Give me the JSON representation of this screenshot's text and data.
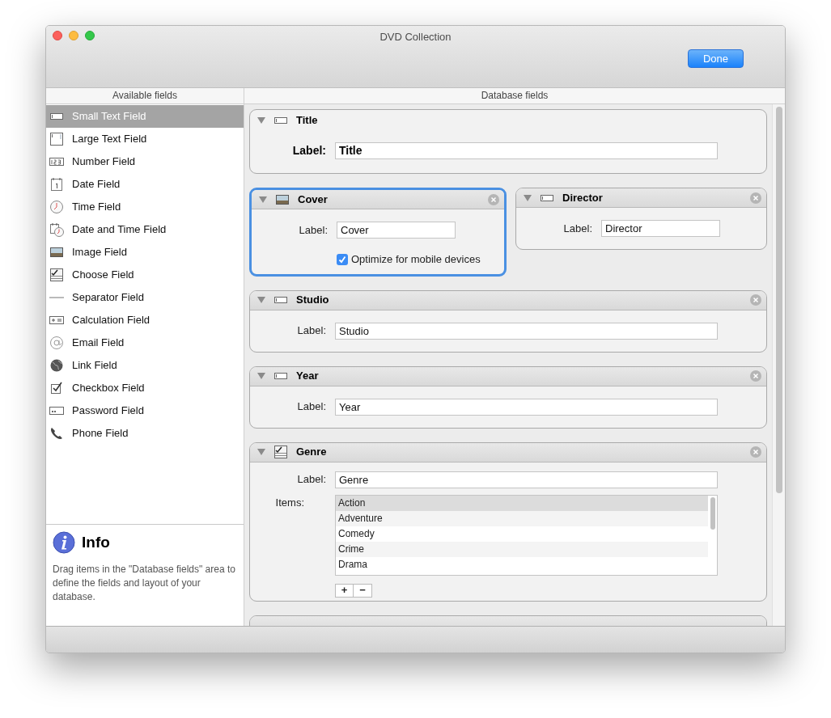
{
  "window": {
    "title": "DVD Collection"
  },
  "toolbar": {
    "done_button": "Done"
  },
  "available_fields": {
    "header": "Available fields",
    "items": [
      {
        "kind": "small_text",
        "label": "Small Text Field",
        "selected": true
      },
      {
        "kind": "large_text",
        "label": "Large Text Field",
        "selected": false
      },
      {
        "kind": "number",
        "label": "Number Field",
        "selected": false
      },
      {
        "kind": "date",
        "label": "Date Field",
        "selected": false
      },
      {
        "kind": "time",
        "label": "Time Field",
        "selected": false
      },
      {
        "kind": "datetime",
        "label": "Date and Time Field",
        "selected": false
      },
      {
        "kind": "image",
        "label": "Image Field",
        "selected": false
      },
      {
        "kind": "choose",
        "label": "Choose Field",
        "selected": false
      },
      {
        "kind": "separator",
        "label": "Separator Field",
        "selected": false
      },
      {
        "kind": "calculation",
        "label": "Calculation Field",
        "selected": false
      },
      {
        "kind": "email",
        "label": "Email Field",
        "selected": false
      },
      {
        "kind": "link",
        "label": "Link Field",
        "selected": false
      },
      {
        "kind": "checkbox",
        "label": "Checkbox Field",
        "selected": false
      },
      {
        "kind": "password",
        "label": "Password Field",
        "selected": false
      },
      {
        "kind": "phone",
        "label": "Phone Field",
        "selected": false
      }
    ],
    "info": {
      "title": "Info",
      "text": "Drag items in the \"Database fields\" area to define the fields and layout of your database."
    }
  },
  "database_fields": {
    "header": "Database fields",
    "rows": [
      {
        "cards": [
          {
            "kind": "primary",
            "title": "Title",
            "label_caption": "Label:",
            "label_value": "Title",
            "selected": false
          }
        ]
      },
      {
        "cards": [
          {
            "kind": "image",
            "title": "Cover",
            "label_caption": "Label:",
            "label_value": "Cover",
            "option": "Optimize for mobile devices",
            "checked": true,
            "selected": true
          },
          {
            "kind": "text",
            "title": "Director",
            "label_caption": "Label:",
            "label_value": "Director",
            "selected": false
          }
        ]
      },
      {
        "cards": [
          {
            "kind": "text",
            "title": "Studio",
            "label_caption": "Label:",
            "label_value": "Studio",
            "selected": false
          }
        ]
      },
      {
        "cards": [
          {
            "kind": "text",
            "title": "Year",
            "label_caption": "Label:",
            "label_value": "Year",
            "selected": false
          }
        ]
      },
      {
        "cards": [
          {
            "kind": "choice",
            "title": "Genre",
            "label_caption": "Label:",
            "label_value": "Genre",
            "items_caption": "Items:",
            "items": [
              {
                "label": "Action",
                "selected": true
              },
              {
                "label": "Adventure",
                "selected": false
              },
              {
                "label": "Comedy",
                "selected": false
              },
              {
                "label": "Crime",
                "selected": false
              },
              {
                "label": "Drama",
                "selected": false
              }
            ],
            "add_button": "+",
            "remove_button": "−",
            "selected": false
          }
        ]
      },
      {
        "cards": [
          {
            "kind": "cut",
            "selected": false
          }
        ]
      }
    ]
  }
}
